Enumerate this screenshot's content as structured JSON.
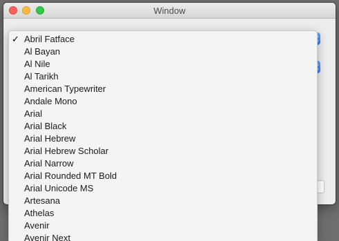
{
  "window": {
    "title": "Window"
  },
  "font_menu": {
    "selected": "Abril Fatface",
    "check_mark": "✓",
    "items": [
      "Abril Fatface",
      "Al Bayan",
      "Al Nile",
      "Al Tarikh",
      "American Typewriter",
      "Andale Mono",
      "Arial",
      "Arial Black",
      "Arial Hebrew",
      "Arial Hebrew Scholar",
      "Arial Narrow",
      "Arial Rounded MT Bold",
      "Arial Unicode MS",
      "Artesana",
      "Athelas",
      "Avenir",
      "Avenir Next"
    ]
  }
}
